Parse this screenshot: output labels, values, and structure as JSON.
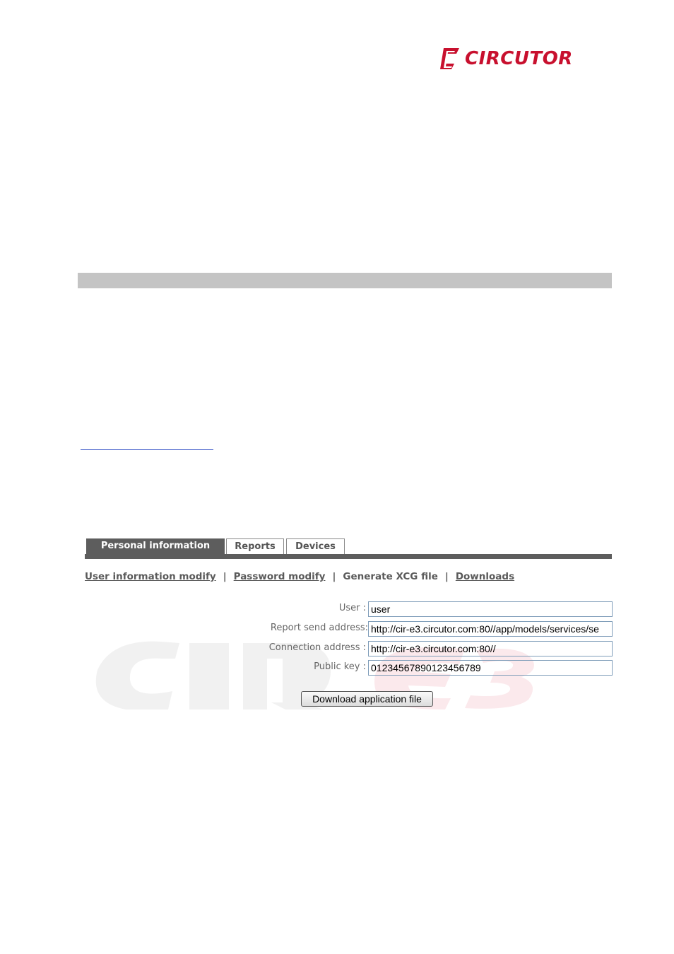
{
  "brand": {
    "logo_text": "CIRCUTOR",
    "logo_color": "#c8102e",
    "logo_icon": "circutor-c-logo-icon"
  },
  "app": {
    "tabs": [
      {
        "label": "Personal information",
        "active": true
      },
      {
        "label": "Reports",
        "active": false
      },
      {
        "label": "Devices",
        "active": false
      }
    ],
    "subnav": {
      "user_info_modify": "User information modify",
      "password_modify": "Password modify",
      "generate_xcg": "Generate XCG file",
      "downloads": "Downloads",
      "separator": "|"
    },
    "form": {
      "user_label": "User :",
      "user_value": "user",
      "report_label": "Report send address:",
      "report_value": "http://cir-e3.circutor.com:80//app/models/services/se",
      "connection_label": "Connection address :",
      "connection_value": "http://cir-e3.circutor.com:80//",
      "public_key_label": "Public key :",
      "public_key_value": "01234567890123456789"
    },
    "download_button": "Download application file",
    "watermark_icon": "cir-e3-watermark-icon"
  }
}
